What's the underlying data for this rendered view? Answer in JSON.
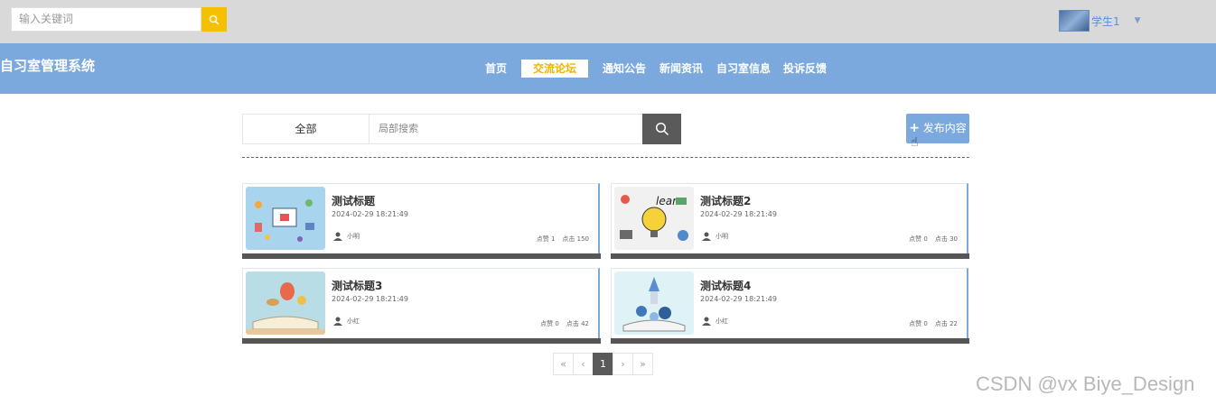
{
  "topbar": {
    "search_placeholder": "输入关键词",
    "user_name": "学生1"
  },
  "nav": {
    "brand": "自习室管理系统",
    "items": [
      {
        "label": "首页",
        "active": false
      },
      {
        "label": "交流论坛",
        "active": true
      },
      {
        "label": "通知公告",
        "active": false
      },
      {
        "label": "新闻资讯",
        "active": false
      },
      {
        "label": "自习室信息",
        "active": false
      },
      {
        "label": "投诉反馈",
        "active": false
      }
    ]
  },
  "filter": {
    "category": "全部",
    "search_placeholder": "局部搜索"
  },
  "publish_label": "发布内容",
  "posts": [
    {
      "title": "测试标题",
      "date": "2024-02-29 18:21:49",
      "author": "小明",
      "likes_label": "点赞 1",
      "clicks_label": "点击 150"
    },
    {
      "title": "测试标题2",
      "date": "2024-02-29 18:21:49",
      "author": "小明",
      "likes_label": "点赞 0",
      "clicks_label": "点击 30"
    },
    {
      "title": "测试标题3",
      "date": "2024-02-29 18:21:49",
      "author": "小红",
      "likes_label": "点赞 0",
      "clicks_label": "点击 42"
    },
    {
      "title": "测试标题4",
      "date": "2024-02-29 18:21:49",
      "author": "小红",
      "likes_label": "点赞 0",
      "clicks_label": "点击 22"
    }
  ],
  "pagination": {
    "first": "«",
    "prev": "‹",
    "current": "1",
    "next": "›",
    "last": "»"
  },
  "watermark": "CSDN @vx Biye_Design",
  "colors": {
    "nav_bg": "#7ba9de",
    "accent_yellow": "#f5c000",
    "dark_button": "#5a5a5a"
  }
}
